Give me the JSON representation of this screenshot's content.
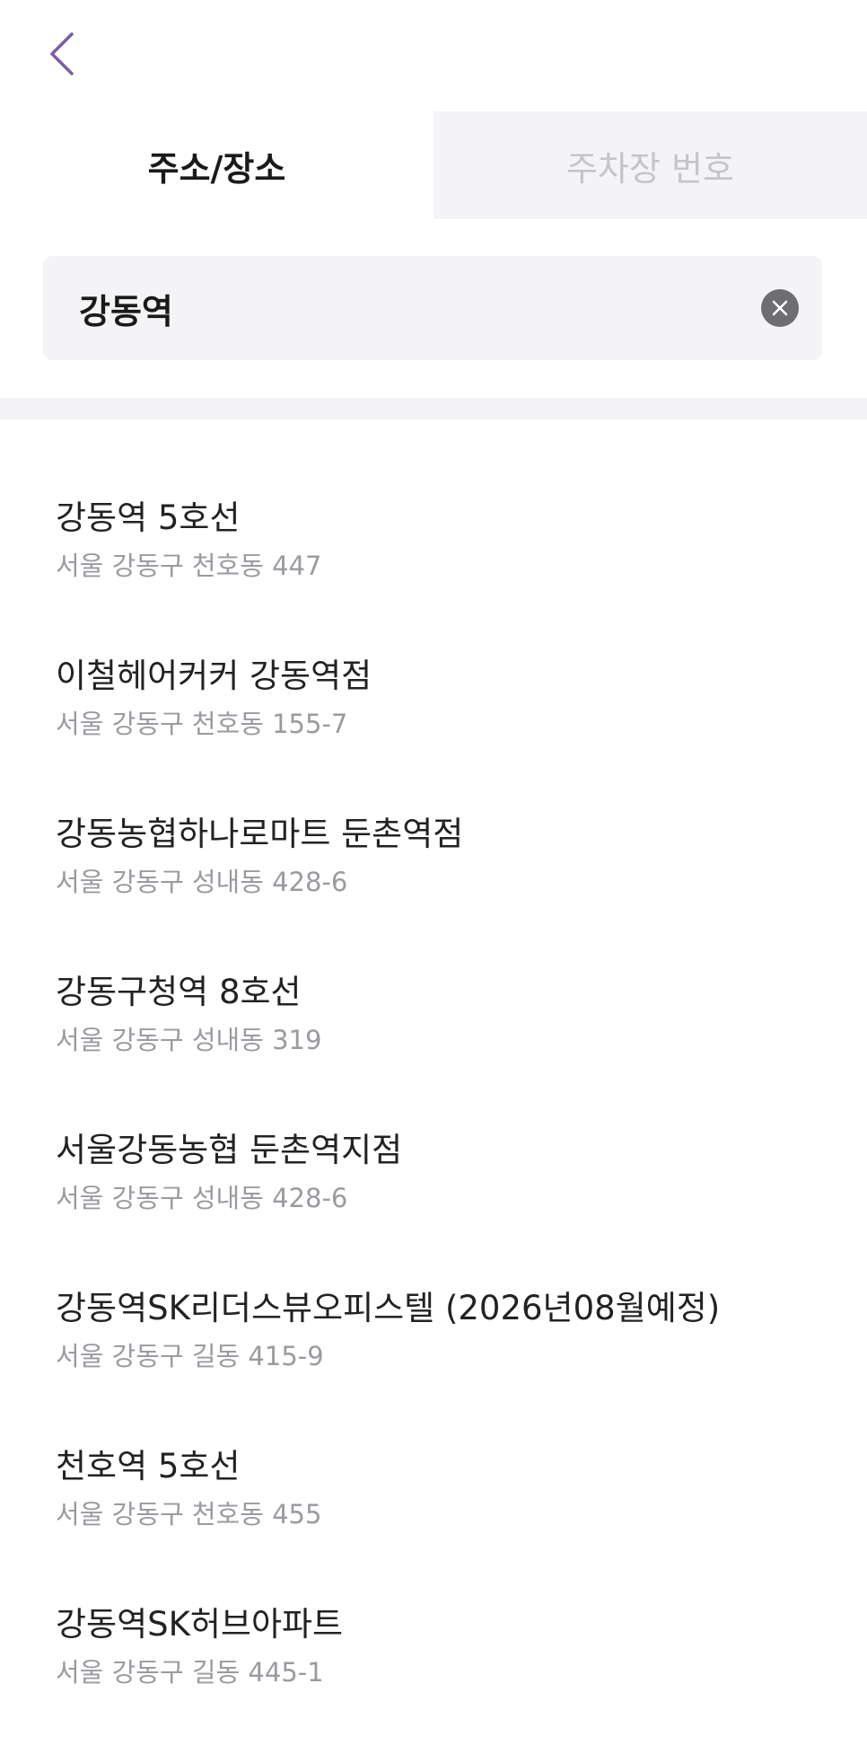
{
  "header": {
    "back_icon": "chevron-left-icon",
    "accent_color": "#7b5ba6"
  },
  "tabs": [
    {
      "label": "주소/장소",
      "active": true
    },
    {
      "label": "주차장 번호",
      "active": false
    }
  ],
  "search": {
    "value": "강동역",
    "clear_icon": "clear-circle-icon"
  },
  "results": [
    {
      "name": "강동역 5호선",
      "address": "서울 강동구 천호동 447"
    },
    {
      "name": "이철헤어커커 강동역점",
      "address": "서울 강동구 천호동 155-7"
    },
    {
      "name": "강동농협하나로마트 둔촌역점",
      "address": "서울 강동구 성내동 428-6"
    },
    {
      "name": "강동구청역 8호선",
      "address": "서울 강동구 성내동 319"
    },
    {
      "name": "서울강동농협 둔촌역지점",
      "address": "서울 강동구 성내동 428-6"
    },
    {
      "name": "강동역SK리더스뷰오피스텔 (2026년08월예정)",
      "address": "서울 강동구 길동 415-9"
    },
    {
      "name": "천호역 5호선",
      "address": "서울 강동구 천호동 455"
    },
    {
      "name": "강동역SK허브아파트",
      "address": "서울 강동구 길동 445-1"
    }
  ]
}
